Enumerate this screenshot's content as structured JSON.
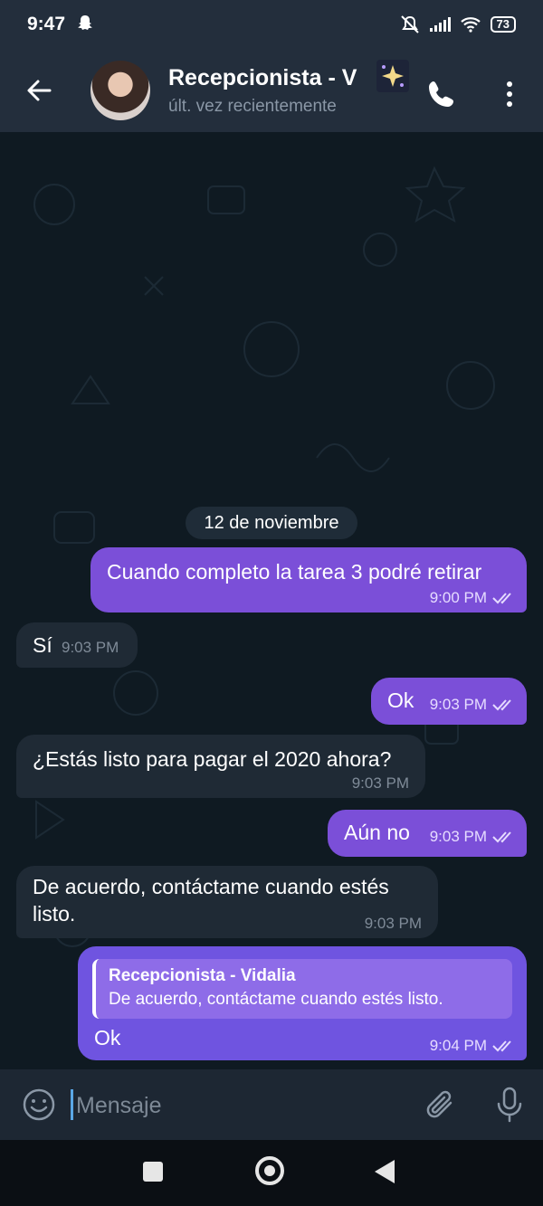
{
  "status_bar": {
    "time": "9:47",
    "battery": "73"
  },
  "header": {
    "title": "Recepcionista - V",
    "subtitle": "últ. vez recientemente"
  },
  "date_separator": "12 de noviembre",
  "messages": [
    {
      "direction": "out",
      "text": "Cuando completo la tarea 3 podré retirar",
      "time": "9:00 PM",
      "read": true
    },
    {
      "direction": "in",
      "text": "Sí",
      "time": "9:03 PM"
    },
    {
      "direction": "out",
      "text": "Ok",
      "time": "9:03 PM",
      "read": true
    },
    {
      "direction": "in",
      "text": "¿Estás listo para pagar el 2020 ahora?",
      "time": "9:03 PM"
    },
    {
      "direction": "out",
      "text": "Aún no",
      "time": "9:03 PM",
      "read": true
    },
    {
      "direction": "in",
      "text_line1": "De acuerdo, contáctame cuando estés",
      "text_line2": "listo.",
      "time": "9:03 PM"
    },
    {
      "direction": "out",
      "reply_to": {
        "author": "Recepcionista - Vidalia",
        "text": "De acuerdo, contáctame cuando estés listo."
      },
      "text": "Ok",
      "time": "9:04 PM",
      "read": true
    }
  ],
  "input": {
    "placeholder": "Mensaje"
  },
  "icons": {
    "back": "arrow-back-icon",
    "call": "phone-icon",
    "menu": "more-vert-icon",
    "emoji": "emoji-icon",
    "attach": "paperclip-icon",
    "mic": "microphone-icon",
    "sparkle": "sparkle-icon"
  },
  "colors": {
    "outgoing_bubble": "#7b4fd8",
    "incoming_bubble": "#1f2a35",
    "header_bg": "#232e3c",
    "chat_bg": "#0f1a22",
    "accent": "#5aa7e6"
  }
}
